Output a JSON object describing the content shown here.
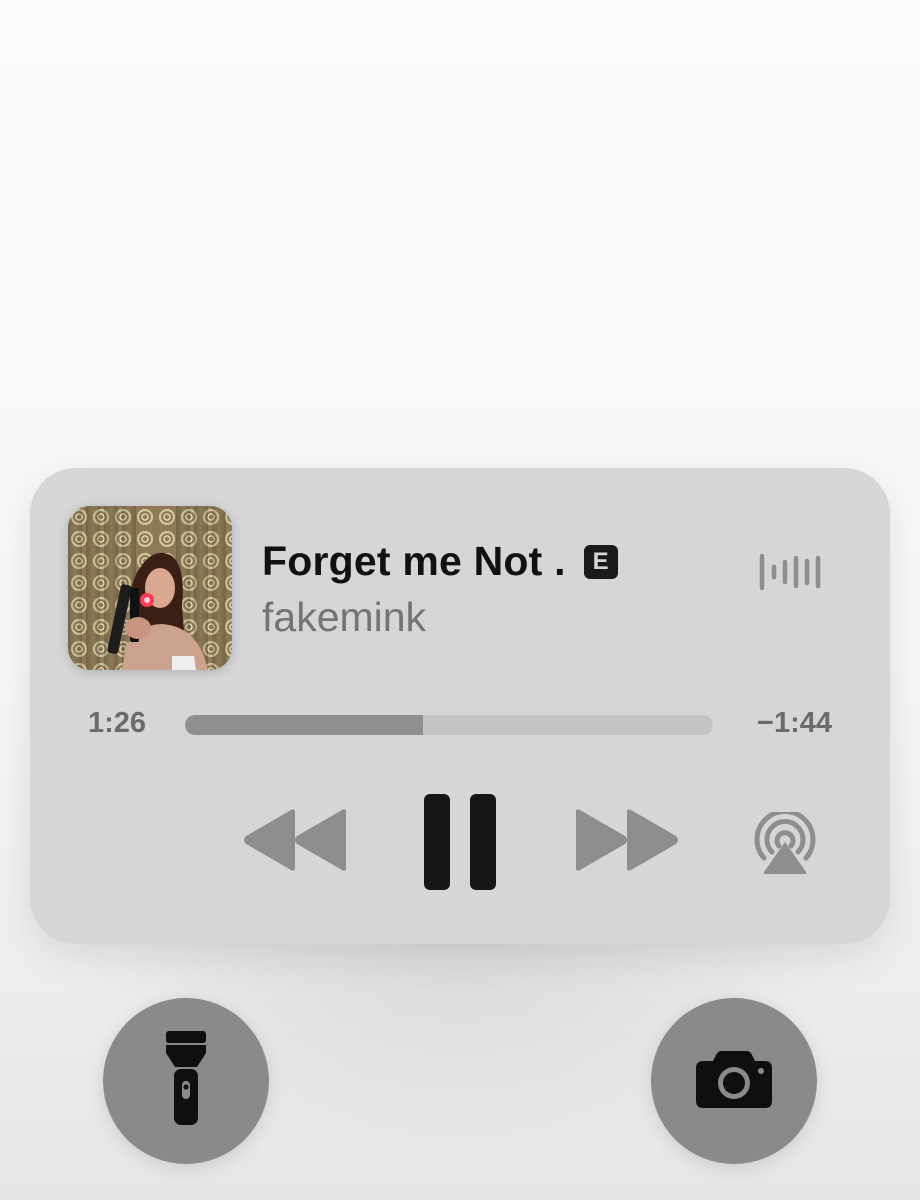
{
  "now_playing": {
    "title": "Forget me Not .",
    "explicit_badge": "E",
    "artist": "fakemink",
    "elapsed": "1:26",
    "remaining": "−1:44",
    "progress_fraction": 0.45,
    "icons": {
      "artwork": "album-artwork",
      "waveform": "audio-waveform-icon",
      "rewind": "rewind-icon",
      "pause": "pause-icon",
      "forward": "fast-forward-icon",
      "airplay": "airplay-audio-icon"
    }
  },
  "lockscreen": {
    "left_button_icon": "flashlight-icon",
    "right_button_icon": "camera-icon"
  },
  "colors": {
    "widget_background": "#d6d6d6",
    "title_text": "#111111",
    "artist_text": "#747474",
    "control_gray": "#8e8e8e",
    "control_dark": "#161616",
    "round_button": "#8a8a8a"
  }
}
